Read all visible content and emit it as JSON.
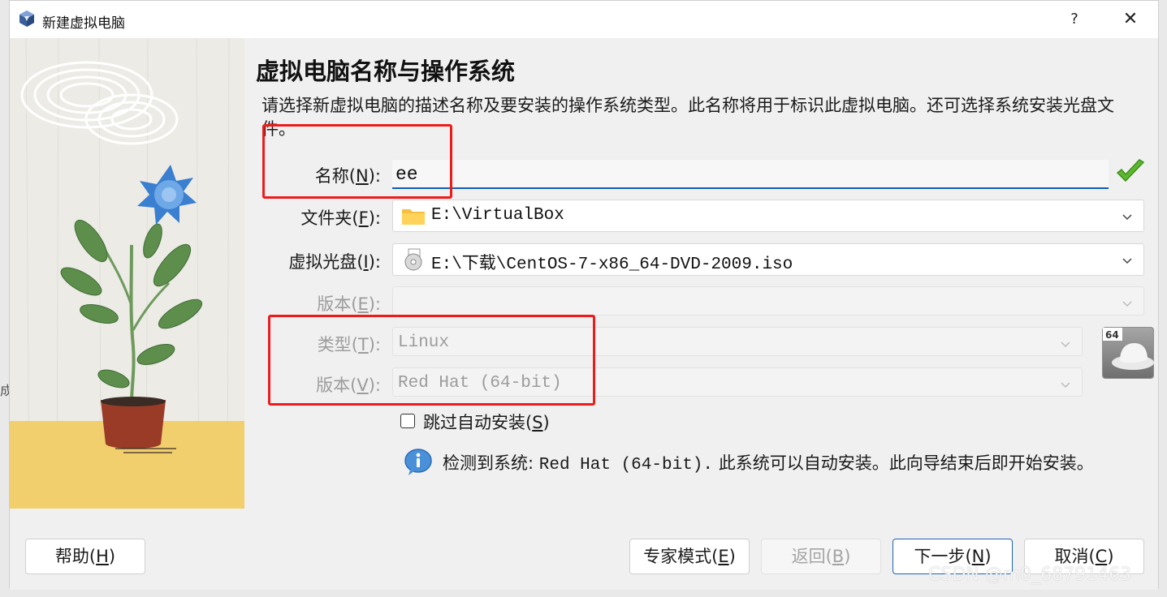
{
  "window": {
    "title": "新建虚拟电脑",
    "help_label": "?",
    "close_label": "✕"
  },
  "page": {
    "heading": "虚拟电脑名称与操作系统",
    "description": "请选择新虚拟电脑的描述名称及要安装的操作系统类型。此名称将用于标识此虚拟电脑。还可选择系统安装光盘文件。"
  },
  "form": {
    "name": {
      "label": "名称",
      "mnemonic": "N",
      "value": "ee",
      "suffix": "):",
      "prefix": "("
    },
    "folder": {
      "label": "文件夹",
      "mnemonic": "F",
      "value": "E:\\VirtualBox"
    },
    "iso": {
      "label": "虚拟光盘",
      "mnemonic": "I",
      "value": "E:\\下载\\CentOS-7-x86_64-DVD-2009.iso"
    },
    "edition": {
      "label": "版本",
      "mnemonic": "E",
      "value": ""
    },
    "type": {
      "label": "类型",
      "mnemonic": "T",
      "value": "Linux"
    },
    "version": {
      "label": "版本",
      "mnemonic": "V",
      "value": "Red Hat (64-bit)"
    },
    "skip_unattended": {
      "label": "跳过自动安装",
      "mnemonic": "S",
      "checked": false
    }
  },
  "os_badge": "64",
  "info": {
    "prefix": "检测到系统: ",
    "os": "Red Hat (64-bit).",
    "suffix": " 此系统可以自动安装。此向导结束后即开始安装。"
  },
  "buttons": {
    "help": {
      "label": "帮助",
      "mnemonic": "H"
    },
    "expert": {
      "label": "专家模式",
      "mnemonic": "E"
    },
    "back": {
      "label": "返回",
      "mnemonic": "B"
    },
    "next": {
      "label": "下一步",
      "mnemonic": "N"
    },
    "cancel": {
      "label": "取消",
      "mnemonic": "C"
    }
  },
  "watermark": "CSDN @m0_68791463",
  "edge_fragment": "成",
  "colors": {
    "accent": "#0f5fb0",
    "annotation_red": "#ee1b1b",
    "check_green": "#5cb82e"
  }
}
